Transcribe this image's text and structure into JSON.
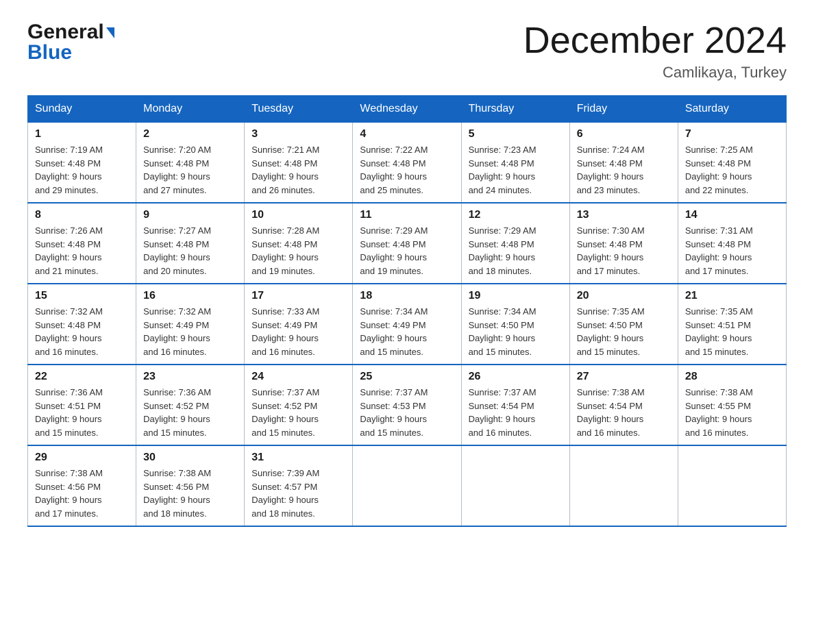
{
  "header": {
    "logo_line1": "General",
    "logo_line2": "Blue",
    "month_title": "December 2024",
    "location": "Camlikaya, Turkey"
  },
  "weekdays": [
    "Sunday",
    "Monday",
    "Tuesday",
    "Wednesday",
    "Thursday",
    "Friday",
    "Saturday"
  ],
  "weeks": [
    [
      {
        "day": "1",
        "sunrise": "7:19 AM",
        "sunset": "4:48 PM",
        "daylight": "9 hours and 29 minutes."
      },
      {
        "day": "2",
        "sunrise": "7:20 AM",
        "sunset": "4:48 PM",
        "daylight": "9 hours and 27 minutes."
      },
      {
        "day": "3",
        "sunrise": "7:21 AM",
        "sunset": "4:48 PM",
        "daylight": "9 hours and 26 minutes."
      },
      {
        "day": "4",
        "sunrise": "7:22 AM",
        "sunset": "4:48 PM",
        "daylight": "9 hours and 25 minutes."
      },
      {
        "day": "5",
        "sunrise": "7:23 AM",
        "sunset": "4:48 PM",
        "daylight": "9 hours and 24 minutes."
      },
      {
        "day": "6",
        "sunrise": "7:24 AM",
        "sunset": "4:48 PM",
        "daylight": "9 hours and 23 minutes."
      },
      {
        "day": "7",
        "sunrise": "7:25 AM",
        "sunset": "4:48 PM",
        "daylight": "9 hours and 22 minutes."
      }
    ],
    [
      {
        "day": "8",
        "sunrise": "7:26 AM",
        "sunset": "4:48 PM",
        "daylight": "9 hours and 21 minutes."
      },
      {
        "day": "9",
        "sunrise": "7:27 AM",
        "sunset": "4:48 PM",
        "daylight": "9 hours and 20 minutes."
      },
      {
        "day": "10",
        "sunrise": "7:28 AM",
        "sunset": "4:48 PM",
        "daylight": "9 hours and 19 minutes."
      },
      {
        "day": "11",
        "sunrise": "7:29 AM",
        "sunset": "4:48 PM",
        "daylight": "9 hours and 19 minutes."
      },
      {
        "day": "12",
        "sunrise": "7:29 AM",
        "sunset": "4:48 PM",
        "daylight": "9 hours and 18 minutes."
      },
      {
        "day": "13",
        "sunrise": "7:30 AM",
        "sunset": "4:48 PM",
        "daylight": "9 hours and 17 minutes."
      },
      {
        "day": "14",
        "sunrise": "7:31 AM",
        "sunset": "4:48 PM",
        "daylight": "9 hours and 17 minutes."
      }
    ],
    [
      {
        "day": "15",
        "sunrise": "7:32 AM",
        "sunset": "4:48 PM",
        "daylight": "9 hours and 16 minutes."
      },
      {
        "day": "16",
        "sunrise": "7:32 AM",
        "sunset": "4:49 PM",
        "daylight": "9 hours and 16 minutes."
      },
      {
        "day": "17",
        "sunrise": "7:33 AM",
        "sunset": "4:49 PM",
        "daylight": "9 hours and 16 minutes."
      },
      {
        "day": "18",
        "sunrise": "7:34 AM",
        "sunset": "4:49 PM",
        "daylight": "9 hours and 15 minutes."
      },
      {
        "day": "19",
        "sunrise": "7:34 AM",
        "sunset": "4:50 PM",
        "daylight": "9 hours and 15 minutes."
      },
      {
        "day": "20",
        "sunrise": "7:35 AM",
        "sunset": "4:50 PM",
        "daylight": "9 hours and 15 minutes."
      },
      {
        "day": "21",
        "sunrise": "7:35 AM",
        "sunset": "4:51 PM",
        "daylight": "9 hours and 15 minutes."
      }
    ],
    [
      {
        "day": "22",
        "sunrise": "7:36 AM",
        "sunset": "4:51 PM",
        "daylight": "9 hours and 15 minutes."
      },
      {
        "day": "23",
        "sunrise": "7:36 AM",
        "sunset": "4:52 PM",
        "daylight": "9 hours and 15 minutes."
      },
      {
        "day": "24",
        "sunrise": "7:37 AM",
        "sunset": "4:52 PM",
        "daylight": "9 hours and 15 minutes."
      },
      {
        "day": "25",
        "sunrise": "7:37 AM",
        "sunset": "4:53 PM",
        "daylight": "9 hours and 15 minutes."
      },
      {
        "day": "26",
        "sunrise": "7:37 AM",
        "sunset": "4:54 PM",
        "daylight": "9 hours and 16 minutes."
      },
      {
        "day": "27",
        "sunrise": "7:38 AM",
        "sunset": "4:54 PM",
        "daylight": "9 hours and 16 minutes."
      },
      {
        "day": "28",
        "sunrise": "7:38 AM",
        "sunset": "4:55 PM",
        "daylight": "9 hours and 16 minutes."
      }
    ],
    [
      {
        "day": "29",
        "sunrise": "7:38 AM",
        "sunset": "4:56 PM",
        "daylight": "9 hours and 17 minutes."
      },
      {
        "day": "30",
        "sunrise": "7:38 AM",
        "sunset": "4:56 PM",
        "daylight": "9 hours and 18 minutes."
      },
      {
        "day": "31",
        "sunrise": "7:39 AM",
        "sunset": "4:57 PM",
        "daylight": "9 hours and 18 minutes."
      },
      null,
      null,
      null,
      null
    ]
  ],
  "labels": {
    "sunrise": "Sunrise:",
    "sunset": "Sunset:",
    "daylight": "Daylight:"
  }
}
